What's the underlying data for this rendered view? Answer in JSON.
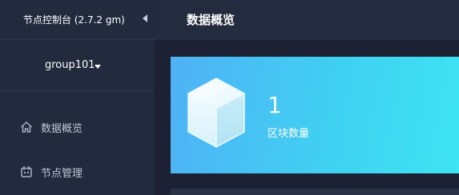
{
  "sidebar": {
    "app_title": "节点控制台 (2.7.2 gm)",
    "collapse_icon": "caret-left-icon",
    "group": {
      "label": "group101",
      "caret_icon": "caret-down-icon"
    },
    "items": [
      {
        "label": "数据概览",
        "icon": "home-icon"
      },
      {
        "label": "节点管理",
        "icon": "calendar-icon"
      }
    ]
  },
  "main": {
    "title": "数据概览",
    "stat_card": {
      "value": "1",
      "label": "区块数量",
      "icon": "cube-icon"
    }
  },
  "colors": {
    "sidebar_bg": "#222a3d",
    "main_bg": "#1c2233",
    "card_gradient_start": "#4fb1f5",
    "card_gradient_end": "#3de4f2"
  }
}
